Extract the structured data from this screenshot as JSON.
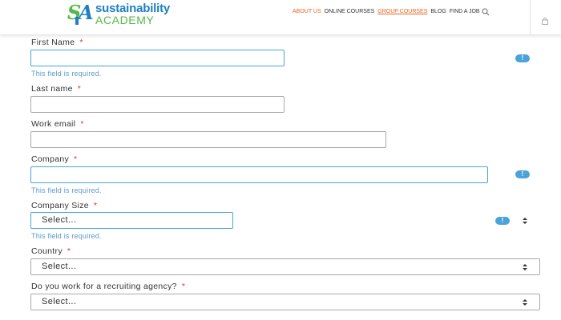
{
  "header": {
    "logo_mark_s": "S",
    "logo_mark_a": "A",
    "logo_line1": "sustainability",
    "logo_line2": "ACADEMY",
    "nav": [
      {
        "label": "ABOUT US"
      },
      {
        "label": "ONLINE COURSES"
      },
      {
        "label": "GROUP COURSES"
      },
      {
        "label": "BLOG"
      },
      {
        "label": "FIND A JOB"
      }
    ],
    "search_icon": "search-icon",
    "cart_icon": "shopping-bag-icon"
  },
  "form": {
    "required_mark": "*",
    "error_text": "This field is required.",
    "error_icon": "!",
    "first_name": {
      "label": "First Name",
      "value": ""
    },
    "last_name": {
      "label": "Last name",
      "value": ""
    },
    "work_email": {
      "label": "Work email",
      "value": ""
    },
    "company": {
      "label": "Company",
      "value": ""
    },
    "company_size": {
      "label": "Company Size",
      "value": "Select..."
    },
    "country": {
      "label": "Country",
      "value": "Select..."
    },
    "recruiting": {
      "label": "Do you work for a recruiting agency?",
      "value": "Select..."
    }
  },
  "colors": {
    "brand_blue": "#1f7fc1",
    "brand_green": "#55b848",
    "nav_accent": "#e8651f",
    "error_blue": "#4aa3d9"
  }
}
